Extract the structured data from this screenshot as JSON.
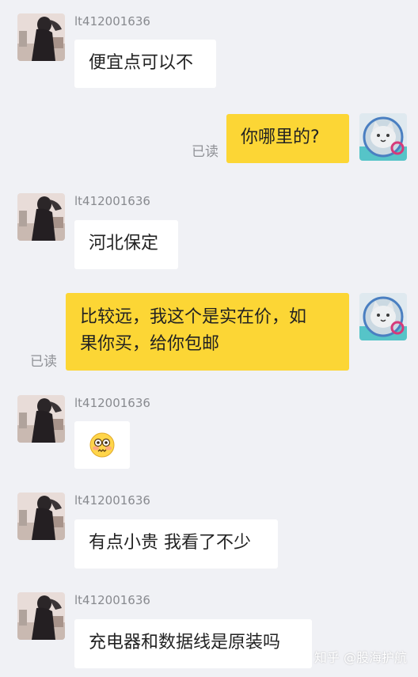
{
  "messages": [
    {
      "sender": "lt412001636",
      "text": "便宜点可以不"
    },
    {
      "text": "你哪里的?",
      "status": "已读"
    },
    {
      "sender": "lt412001636",
      "text": "河北保定"
    },
    {
      "text": "比较远，我这个是实在价，如果你买，给你包邮",
      "line1": "比较远，我这个是实在价，如",
      "line2": "果你买，给你包邮",
      "status": "已读"
    },
    {
      "sender": "lt412001636",
      "emoji": "flushed-face-emoji"
    },
    {
      "sender": "lt412001636",
      "text": "有点小贵 我看了不少"
    },
    {
      "sender": "lt412001636",
      "text": "充电器和数据线是原装吗"
    }
  ],
  "watermark": "知乎 @股海护航",
  "colors": {
    "background": "#f0f1f5",
    "incoming_bubble": "#ffffff",
    "outgoing_bubble": "#fcd635"
  }
}
